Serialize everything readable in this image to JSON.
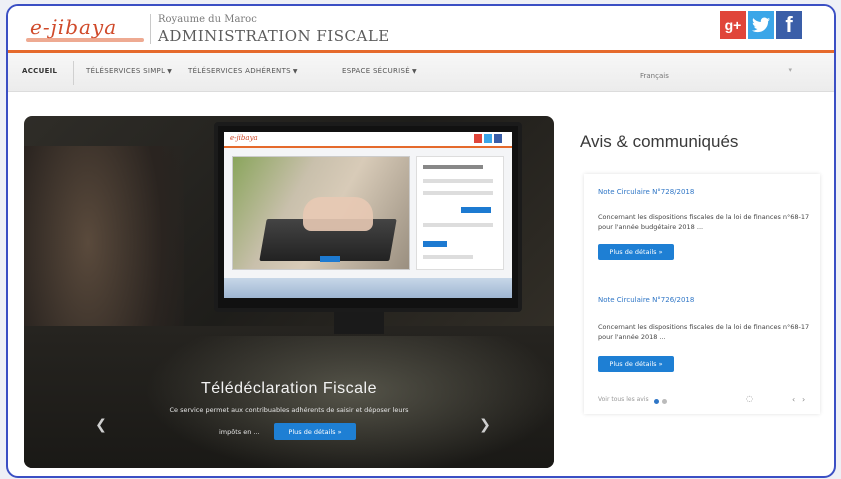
{
  "header": {
    "logo_text": "e-jibaya",
    "kingdom_text": "Royaume du Maroc",
    "admin_text": "ADMINISTRATION FISCALE",
    "social": [
      {
        "name": "google-plus",
        "glyph": "g+",
        "color": "#e0453a"
      },
      {
        "name": "twitter",
        "glyph": "t",
        "color": "#3ba6e8"
      },
      {
        "name": "facebook",
        "glyph": "f",
        "color": "#3a5ea8"
      }
    ]
  },
  "nav": {
    "items": [
      {
        "label": "ACCUEIL",
        "active": true
      },
      {
        "label": "TÉLÉSERVICES SIMPL",
        "has_caret": true
      },
      {
        "label": "TÉLÉSERVICES ADHÉRENTS",
        "has_caret": true
      },
      {
        "label": "ESPACE SÉCURISÉ",
        "has_caret": true
      }
    ],
    "search_placeholder": "Français"
  },
  "hero": {
    "title": "Télédéclaration Fiscale",
    "description": "Ce service permet aux contribuables adhérents de saisir et déposer leurs",
    "cta_label": "impôts en ...",
    "cta_button": "Plus de détails »"
  },
  "news": {
    "title": "Avis & communiqués",
    "items": [
      {
        "title": "Note Circulaire N°728/2018",
        "text": "Concernant les dispositions fiscales de la loi de finances n°68-17 pour l'année budgétaire 2018 ...",
        "more": "Plus de détails »"
      },
      {
        "title": "Note Circulaire N°726/2018",
        "text": "Concernant les dispositions fiscales de la loi de finances n°68-17 pour l'année 2018 ...",
        "more": "Plus de détails »"
      }
    ],
    "footer_text": "Voir tous les avis"
  },
  "colors": {
    "accent": "#e56a2c",
    "link": "#2f76c6",
    "button": "#1e7fd4",
    "frame": "#3b4fc4"
  }
}
